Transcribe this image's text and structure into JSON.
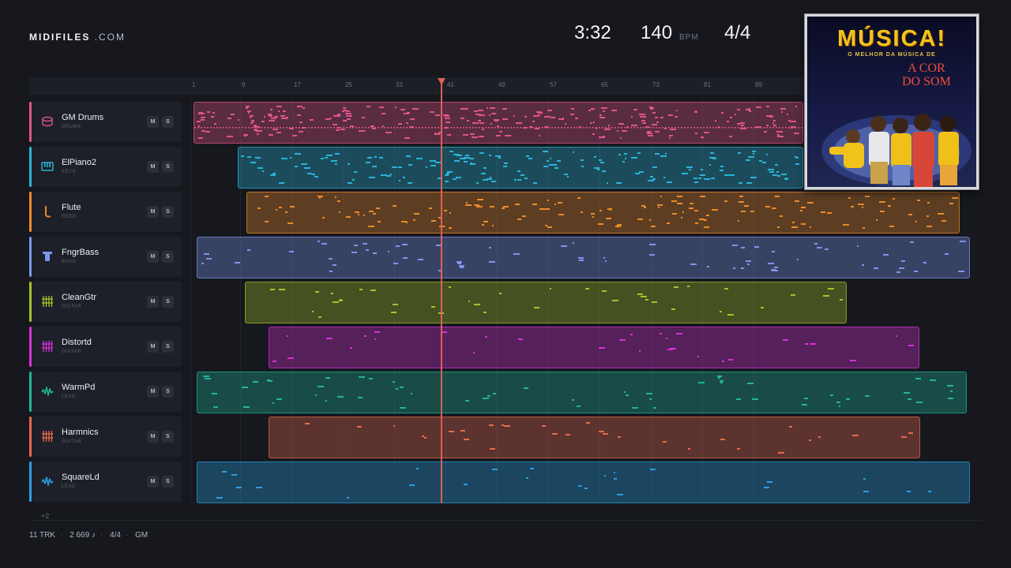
{
  "brand": {
    "bold": "MIDIFILES",
    "light": " .COM"
  },
  "header": {
    "time": "3:32",
    "bpm": "140",
    "bpm_unit": "BPM",
    "signature": "4/4"
  },
  "ruler": {
    "ticks": [
      "1",
      "9",
      "17",
      "25",
      "33",
      "41",
      "49",
      "57",
      "65",
      "73",
      "81",
      "89"
    ]
  },
  "tracks": [
    {
      "name": "GM Drums",
      "type": "DRUMS",
      "color": "#e0548a",
      "icon": "drum-icon",
      "mute": "M",
      "solo": "S"
    },
    {
      "name": "ElPiano2",
      "type": "KEYS",
      "color": "#2bb3d8",
      "icon": "keyboard-icon",
      "mute": "M",
      "solo": "S"
    },
    {
      "name": "Flute",
      "type": "REED",
      "color": "#ee8a2a",
      "icon": "reed-icon",
      "mute": "M",
      "solo": "S"
    },
    {
      "name": "FngrBass",
      "type": "BASS",
      "color": "#7f95ee",
      "icon": "bass-icon",
      "mute": "M",
      "solo": "S"
    },
    {
      "name": "CleanGtr",
      "type": "GUITAR",
      "color": "#a8c22a",
      "icon": "guitar-fret-icon",
      "mute": "M",
      "solo": "S"
    },
    {
      "name": "Distortd",
      "type": "GUITAR",
      "color": "#d831d6",
      "icon": "guitar-fret-icon",
      "mute": "M",
      "solo": "S"
    },
    {
      "name": "WarmPd",
      "type": "LEAD",
      "color": "#22b59a",
      "icon": "waveform-icon",
      "mute": "M",
      "solo": "S"
    },
    {
      "name": "Harmnics",
      "type": "GUITAR",
      "color": "#ea6a4e",
      "icon": "guitar-fret-icon",
      "mute": "M",
      "solo": "S"
    },
    {
      "name": "SquareLd",
      "type": "LEAD",
      "color": "#2a9fe2",
      "icon": "waveform-icon",
      "mute": "M",
      "solo": "S"
    }
  ],
  "more_tracks": "+2",
  "footer": {
    "tracks": "11 TRK",
    "notes": "2 669 ♪",
    "signature": "4/4",
    "standard": "GM"
  },
  "album": {
    "title": "MÚSICA!",
    "subtitle": "O MELHOR DA MÚSICA DE",
    "band_line1": "A COR",
    "band_line2": "DO SOM"
  }
}
